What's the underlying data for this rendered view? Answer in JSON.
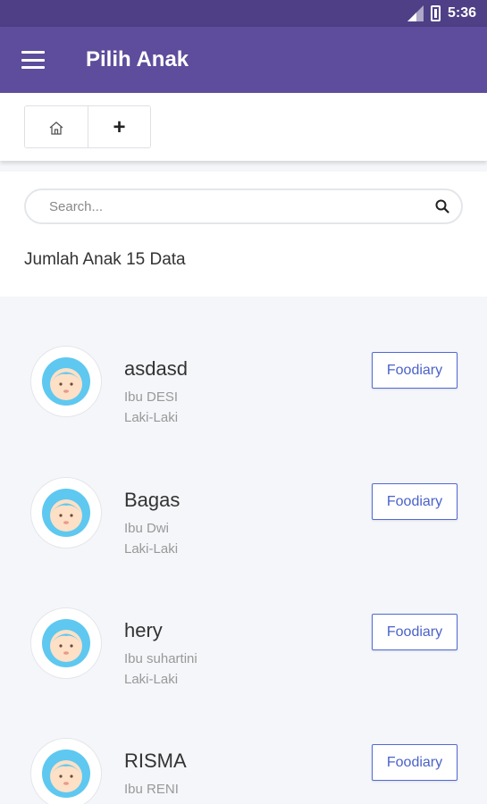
{
  "status_bar": {
    "time": "5:36",
    "signal_icon": "signal-icon",
    "battery_icon": "battery-icon"
  },
  "app_bar": {
    "title": "Pilih Anak",
    "menu_icon": "hamburger-menu-icon",
    "color": "#5e4c9c"
  },
  "toolbar": {
    "home_icon": "home-icon",
    "add_label": "+"
  },
  "search": {
    "placeholder": "Search...",
    "value": "",
    "icon": "search-icon"
  },
  "summary": {
    "count_text": "Jumlah Anak 15 Data"
  },
  "children": [
    {
      "name": "asdasd",
      "mother": "Ibu DESI",
      "gender": "Laki-Laki",
      "button": "Foodiary"
    },
    {
      "name": "Bagas",
      "mother": "Ibu Dwi",
      "gender": "Laki-Laki",
      "button": "Foodiary"
    },
    {
      "name": "hery",
      "mother": "Ibu suhartini",
      "gender": "Laki-Laki",
      "button": "Foodiary"
    },
    {
      "name": "RISMA",
      "mother": "Ibu RENI",
      "gender": "",
      "button": "Foodiary"
    }
  ]
}
